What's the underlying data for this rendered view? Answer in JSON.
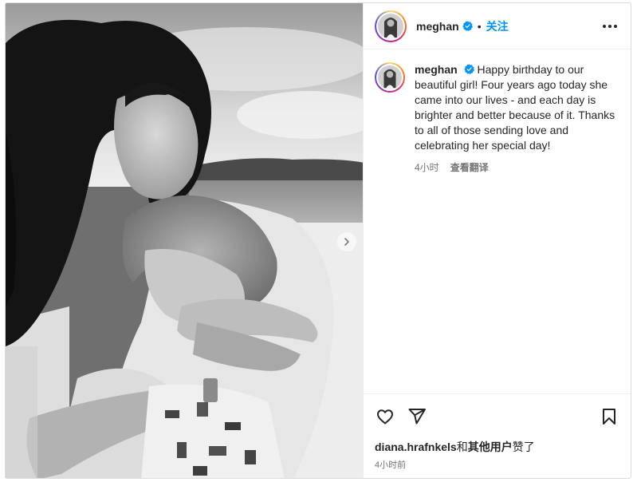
{
  "post": {
    "username": "meghan",
    "follow_label": "关注",
    "dot": "•",
    "caption": "Happy birthday to our beautiful girl! Four years ago today she came into our lives - and each day is brighter and better because of it. Thanks to all of those sending love and celebrating her special day!",
    "time_ago": "4小时",
    "translate_label": "查看翻译",
    "likes_user": "diana.hrafnkels",
    "likes_connector": "和",
    "likes_others": "其他用户",
    "likes_suffix": "赞了",
    "post_time": "4小时前"
  },
  "icons": {
    "verified": "verified-badge-icon",
    "more": "more-options-icon",
    "like": "heart-icon",
    "share": "paper-plane-icon",
    "save": "bookmark-icon",
    "next": "chevron-right-icon"
  },
  "colors": {
    "follow": "#0095f6",
    "verified": "#0095f6",
    "secondary_text": "#737373"
  }
}
